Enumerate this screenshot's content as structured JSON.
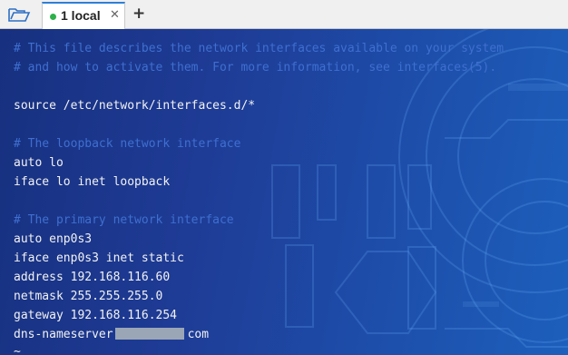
{
  "tabbar": {
    "open_icon": "folder-open-icon",
    "tab_label": "1 local",
    "tab_close": "✕",
    "new_tab": "+",
    "status_color": "#2db14a",
    "accent": "#2e7fd6"
  },
  "terminal": {
    "background_color": "#1b2f86",
    "comment_color": "#3f6fd0",
    "text_color": "#f2f2f2",
    "lines": [
      {
        "type": "comment",
        "text": "# This file describes the network interfaces available on your system"
      },
      {
        "type": "comment",
        "text": "# and how to activate them. For more information, see interfaces(5)."
      },
      {
        "type": "blank",
        "text": ""
      },
      {
        "type": "code",
        "text": "source /etc/network/interfaces.d/*"
      },
      {
        "type": "blank",
        "text": ""
      },
      {
        "type": "comment",
        "text": "# The loopback network interface"
      },
      {
        "type": "code",
        "text": "auto lo"
      },
      {
        "type": "code",
        "text": "iface lo inet loopback"
      },
      {
        "type": "blank",
        "text": ""
      },
      {
        "type": "comment",
        "text": "# The primary network interface"
      },
      {
        "type": "code",
        "text": "auto enp0s3"
      },
      {
        "type": "code",
        "text": "iface enp0s3 inet static"
      },
      {
        "type": "code",
        "text": "address 192.168.116.60"
      },
      {
        "type": "code",
        "text": "netmask 255.255.255.0"
      },
      {
        "type": "code",
        "text": "gateway 192.168.116.254"
      }
    ],
    "dns_prefix": "dns-nameserver",
    "dns_suffix": "com",
    "prompt": "~"
  }
}
